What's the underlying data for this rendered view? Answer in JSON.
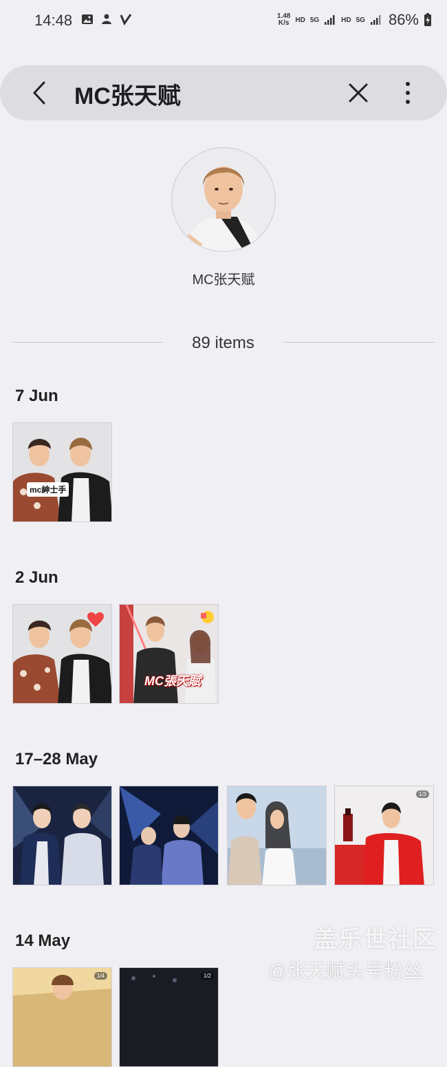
{
  "status_bar": {
    "time": "14:48",
    "net_speed_value": "1.48",
    "net_speed_unit": "K/s",
    "hd1": "HD",
    "sig1": "5G",
    "hd2": "HD",
    "sig2": "5G",
    "battery": "86%"
  },
  "search": {
    "query": "MC张天赋"
  },
  "person": {
    "name": "MC张天赋"
  },
  "summary": {
    "items_count": "89 items"
  },
  "sections": [
    {
      "label": "7 Jun",
      "photos": [
        {
          "caption": "mc紳士手"
        }
      ]
    },
    {
      "label": "2 Jun",
      "photos": [
        {
          "favorite": true
        },
        {
          "overlay_text": "MC張天賦"
        }
      ]
    },
    {
      "label": "17–28 May",
      "photos": [
        {},
        {},
        {},
        {
          "badge": "1/3"
        }
      ]
    },
    {
      "label": "14 May",
      "photos": [
        {
          "badge": "1/4"
        },
        {
          "badge": "1/2"
        }
      ]
    }
  ],
  "watermark": {
    "line1": "盖乐世社区",
    "line2": "@张天赋头号粉丝"
  },
  "colors": {
    "background": "#f0eff4",
    "search_bar": "#dddce1",
    "heart": "#ef4444"
  }
}
